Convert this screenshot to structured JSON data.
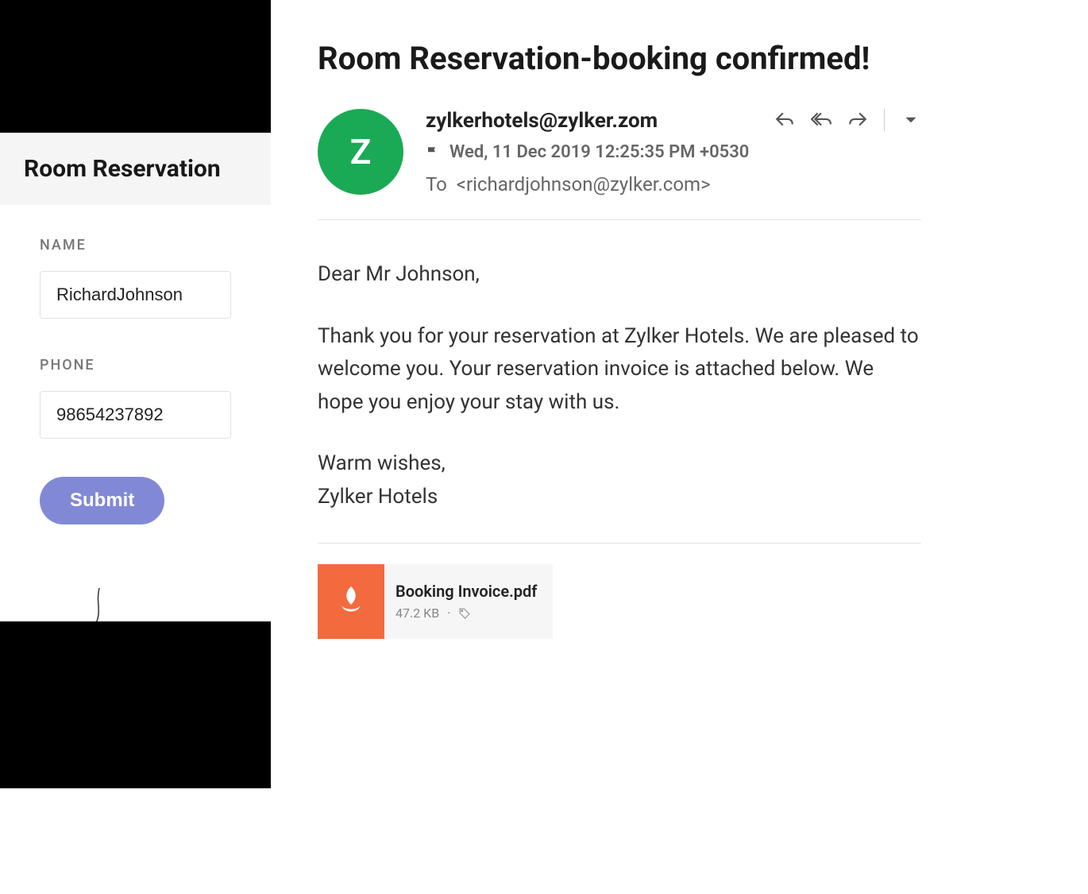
{
  "form": {
    "title": "Room Reservation",
    "name_label": "NAME",
    "name_value": "RichardJohnson",
    "phone_label": "PHONE",
    "phone_value": "98654237892",
    "submit_label": "Submit"
  },
  "email": {
    "subject": "Room Reservation-booking confirmed!",
    "avatar_letter": "Z",
    "sender": "zylkerhotels@zylker.zom",
    "date": "Wed, 11 Dec 2019 12:25:35 PM +0530",
    "to_label": "To",
    "to_address": "<richardjohnson@zylker.com>",
    "greeting": "Dear Mr Johnson,",
    "body": "Thank you for your reservation at Zylker Hotels. We are pleased to welcome you. Your reservation invoice is attached below. We hope you enjoy your stay with us.",
    "closing": "Warm wishes,",
    "signature": "Zylker Hotels",
    "attachment": {
      "name": "Booking Invoice.pdf",
      "size": "47.2 KB"
    }
  }
}
